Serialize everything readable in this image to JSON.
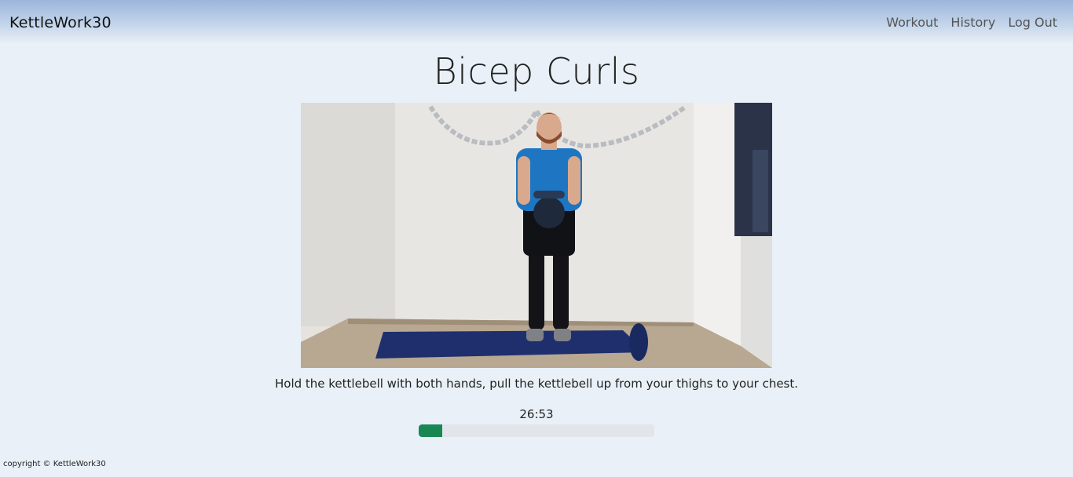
{
  "navbar": {
    "brand": "KettleWork30",
    "links": [
      {
        "label": "Workout"
      },
      {
        "label": "History"
      },
      {
        "label": "Log Out"
      }
    ]
  },
  "exercise": {
    "title": "Bicep Curls",
    "description": "Hold the kettlebell with both hands, pull the kettlebell up from your thighs to your chest.",
    "timer": "26:53",
    "progress_fraction": 0.1,
    "progress_color": "#198754"
  },
  "footer": {
    "copyright": "copyright © KettleWork30"
  }
}
